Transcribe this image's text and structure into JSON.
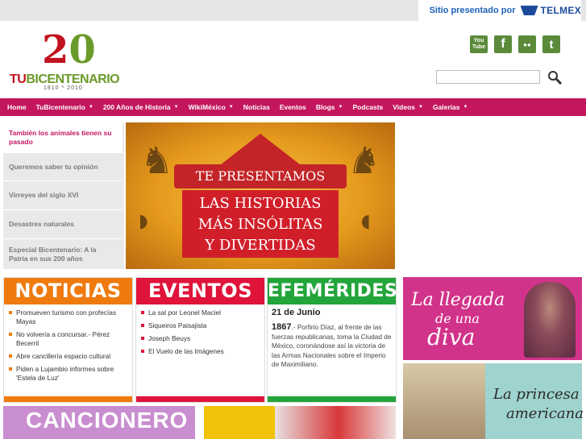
{
  "sponsor": {
    "label": "Sitio presentado por",
    "brand": "TELMEX"
  },
  "logo": {
    "number_a": "2",
    "number_b": "0",
    "name_a": "TU",
    "name_b": "BICENTENARIO",
    "years": "1810 * 2010"
  },
  "social": [
    {
      "name": "youtube-icon",
      "text": "You Tube",
      "color": "#5a8a3a"
    },
    {
      "name": "facebook-icon",
      "text": "f",
      "color": "#5a8a3a"
    },
    {
      "name": "flickr-icon",
      "text": "●●",
      "color": "#5a8a3a"
    },
    {
      "name": "twitter-icon",
      "text": "t",
      "color": "#5a8a3a"
    }
  ],
  "search": {
    "value": ""
  },
  "nav": [
    {
      "label": "Home",
      "caret": false
    },
    {
      "label": "TuBicentenario",
      "caret": true
    },
    {
      "label": "200 Años de Historia",
      "caret": true
    },
    {
      "label": "WikiMéxico",
      "caret": true
    },
    {
      "label": "Noticias",
      "caret": false
    },
    {
      "label": "Eventos",
      "caret": false
    },
    {
      "label": "Blogs",
      "caret": true
    },
    {
      "label": "Podcasts",
      "caret": false
    },
    {
      "label": "Videos",
      "caret": true
    },
    {
      "label": "Galerías",
      "caret": true
    }
  ],
  "sidebar": [
    "También los animales tienen su pasado",
    "Queremos saber tu opinión",
    "Virreyes del siglo XVI",
    "Desastres naturales",
    "Especial Bicentenario: A la Patria en sus 200 años"
  ],
  "hero": {
    "line1": "TE PRESENTAMOS",
    "line2": "LAS HISTORIAS",
    "line3": "MÁS INSÓLITAS",
    "line4": "Y DIVERTIDAS"
  },
  "noticias": {
    "title": "NOTICIAS",
    "color": "#ef7a0e",
    "items": [
      "Promueven turismo con profecías Mayas",
      "No volvería a concursar.- Pérez Becerril",
      "Abre cancillería espacio cultural",
      "Piden a Lujambio informes sobre 'Estela de Luz'"
    ]
  },
  "eventos": {
    "title": "EVENTOS",
    "color": "#e0143a",
    "items": [
      "La sal por Leonel Maciel",
      "Siqueiros Paisajista",
      "Joseph Beuys",
      "El Vuelo de las Imágenes"
    ]
  },
  "efemerides": {
    "title": "EFEMÉRIDES",
    "color": "#22a53a",
    "date": "21 de Junio",
    "year": "1867",
    "text": ".- Porfirio Díaz, al frente de las fuerzas republicanas, toma la Ciudad de México, coronándose así la victoria de las Armas Nacionales sobre el Imperio de Maximiliano."
  },
  "promo1": {
    "line1": "La llegada",
    "line2": "de una",
    "line3": "diva"
  },
  "promo2": {
    "line1": "La princesa",
    "line2": "americana"
  },
  "cancionero": {
    "title": "CANCIONERO"
  }
}
